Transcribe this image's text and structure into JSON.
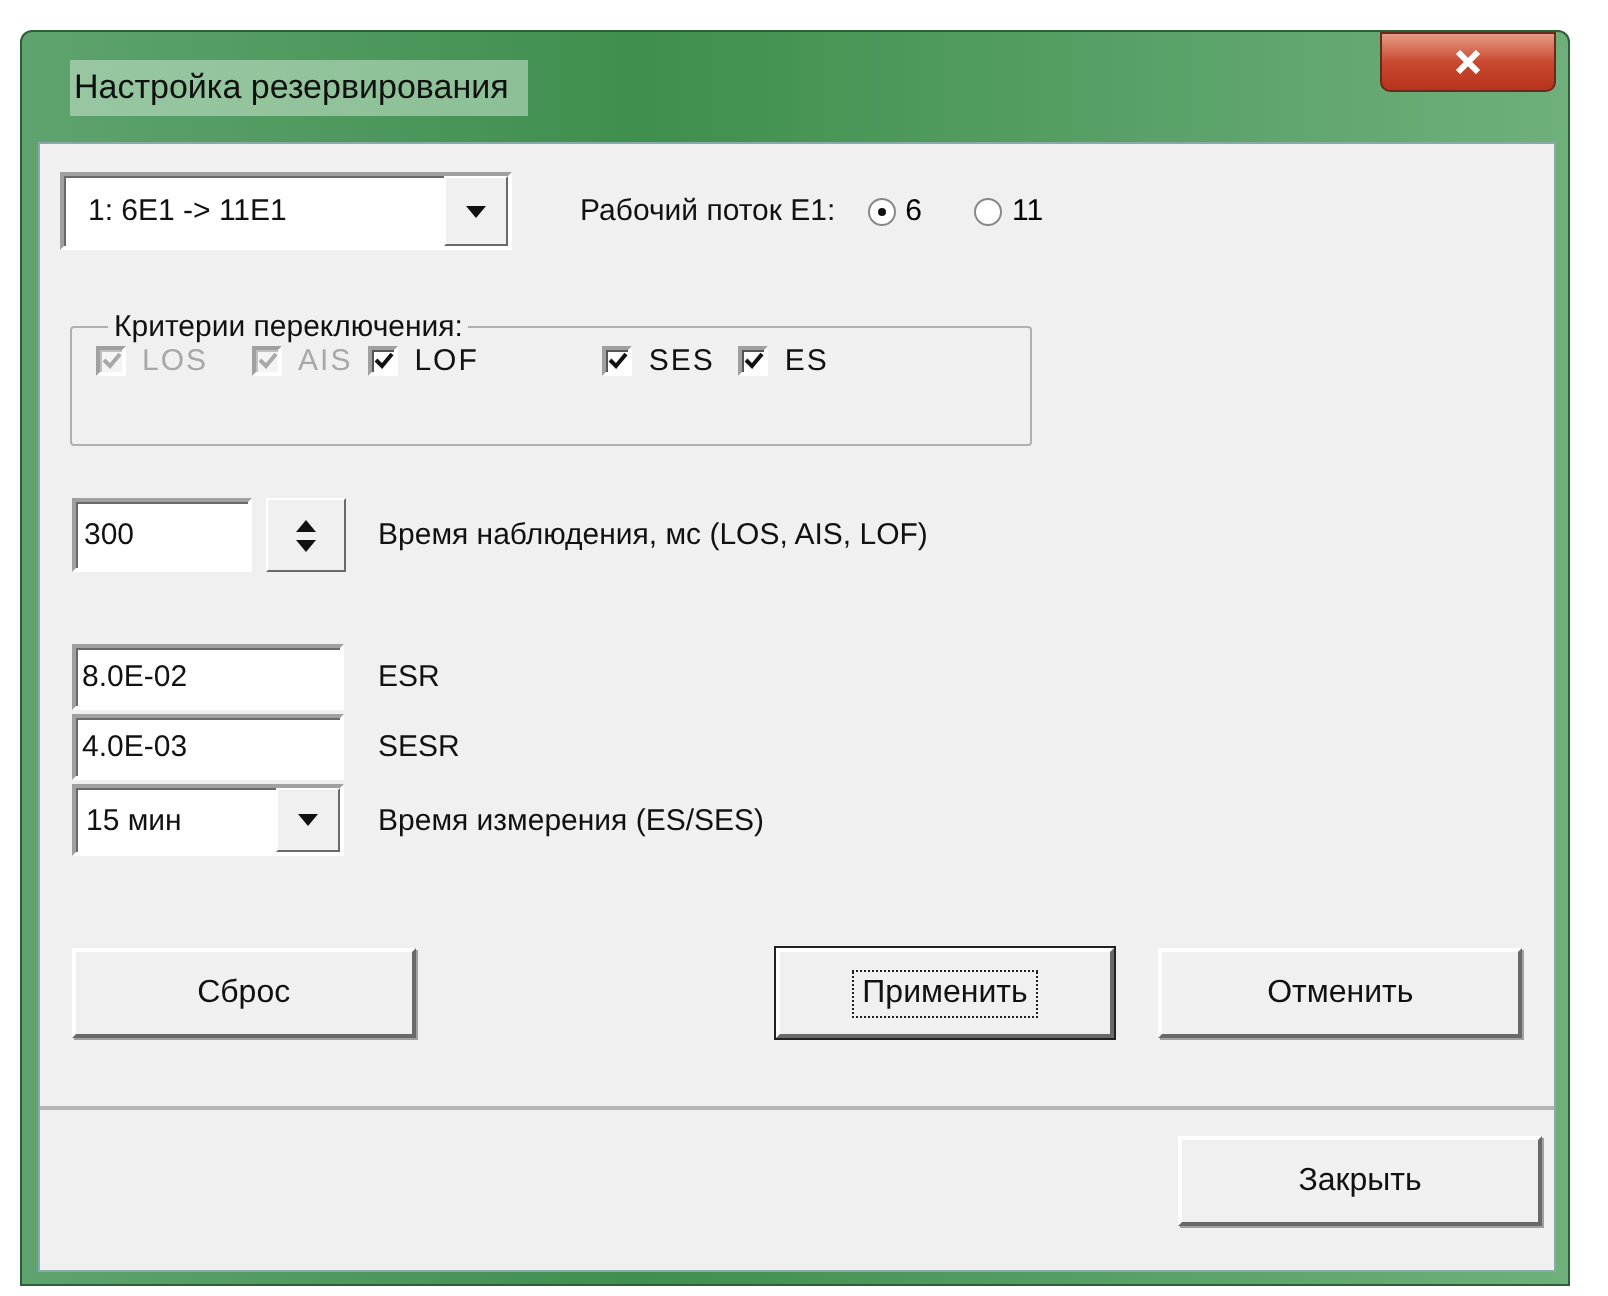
{
  "window": {
    "title": "Настройка резервирования"
  },
  "stream_select": {
    "value": "1: 6E1 -> 11E1"
  },
  "working_stream": {
    "label": "Рабочий поток E1:",
    "options": [
      {
        "label": "6",
        "selected": true
      },
      {
        "label": "11",
        "selected": false
      }
    ]
  },
  "criteria": {
    "title": "Критерии переключения:",
    "items": [
      {
        "label": "LOS",
        "checked": true,
        "disabled": true
      },
      {
        "label": "AIS",
        "checked": true,
        "disabled": true
      },
      {
        "label": "LOF",
        "checked": true,
        "disabled": false
      },
      {
        "label": "SES",
        "checked": true,
        "disabled": false
      },
      {
        "label": "ES",
        "checked": true,
        "disabled": false
      }
    ]
  },
  "observation_time": {
    "value": "300",
    "label": "Время наблюдения, мс (LOS, AIS, LOF)"
  },
  "fields": [
    {
      "value": "8.0E-02",
      "label": "ESR"
    },
    {
      "value": "4.0E-03",
      "label": "SESR"
    }
  ],
  "measure_time": {
    "value": "15 мин",
    "label": "Время измерения (ES/SES)"
  },
  "buttons": [
    {
      "label": "Сброс",
      "focused": false
    },
    {
      "label": "Применить",
      "focused": true
    },
    {
      "label": "Отменить",
      "focused": false
    }
  ],
  "footer_buttons": [
    {
      "label": "Закрыть",
      "focused": false
    }
  ]
}
